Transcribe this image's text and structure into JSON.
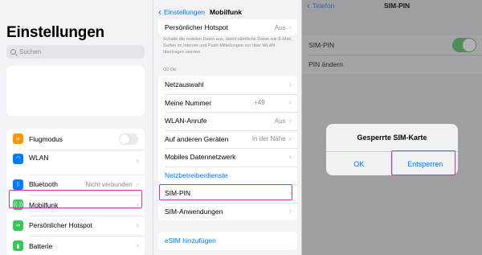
{
  "colors": {
    "highlight": "#d6339c",
    "link": "#007aff",
    "toggle_on": "#4f8e55"
  },
  "settings": {
    "title": "Einstellungen",
    "search_placeholder": "Suchen",
    "rows": [
      {
        "label": "Flugmodus",
        "icon": "airplane-icon",
        "icon_color": "#ff9500",
        "control": "toggle-off"
      },
      {
        "label": "WLAN",
        "icon": "wifi-icon",
        "icon_color": "#007aff",
        "control": "chevron"
      },
      {
        "label": "Bluetooth",
        "icon": "bluetooth-icon",
        "icon_color": "#007aff",
        "value": "Nicht verbunden",
        "control": "chevron"
      },
      {
        "label": "Mobilfunk",
        "icon": "antenna-icon",
        "icon_color": "#34c759",
        "control": "chevron"
      },
      {
        "label": "Persönlicher Hotspot",
        "icon": "hotspot-icon",
        "icon_color": "#34c759",
        "control": "chevron"
      },
      {
        "label": "Batterie",
        "icon": "battery-icon",
        "icon_color": "#34c759",
        "control": "chevron"
      }
    ]
  },
  "mobilfunk": {
    "back_label": "Einstellungen",
    "title": "Mobilfunk",
    "hotspot_row": {
      "label": "Persönlicher Hotspot",
      "value": "Aus"
    },
    "description": "Schalte die mobilen Daten aus, damit sämtliche Daten wie E-Mail, Surfen im Internet und Push-Mitteilungen nur über WLAN übertragen werden.",
    "section_header": "O2-DE",
    "rows": [
      {
        "label": "Netzauswahl",
        "value": ""
      },
      {
        "label": "Meine Nummer",
        "value": "+49"
      },
      {
        "label": "WLAN-Anrufe",
        "value": "Aus"
      },
      {
        "label": "Auf anderen Geräten",
        "value": "In der Nähe"
      },
      {
        "label": "Mobiles Datennetzwerk",
        "value": ""
      }
    ],
    "link_label": "Netzbetreiberdienste",
    "sim_pin_label": "SIM-PIN",
    "sim_apps_label": "SIM-Anwendungen",
    "esim_label": "eSIM hinzufügen"
  },
  "simpin": {
    "back_label": "Telefon",
    "title": "SIM-PIN",
    "toggle_label": "SIM-PIN",
    "change_label": "PIN ändern",
    "alert": {
      "title": "Gesperrte SIM-Karte",
      "ok_label": "OK",
      "unlock_label": "Entsperren"
    }
  }
}
